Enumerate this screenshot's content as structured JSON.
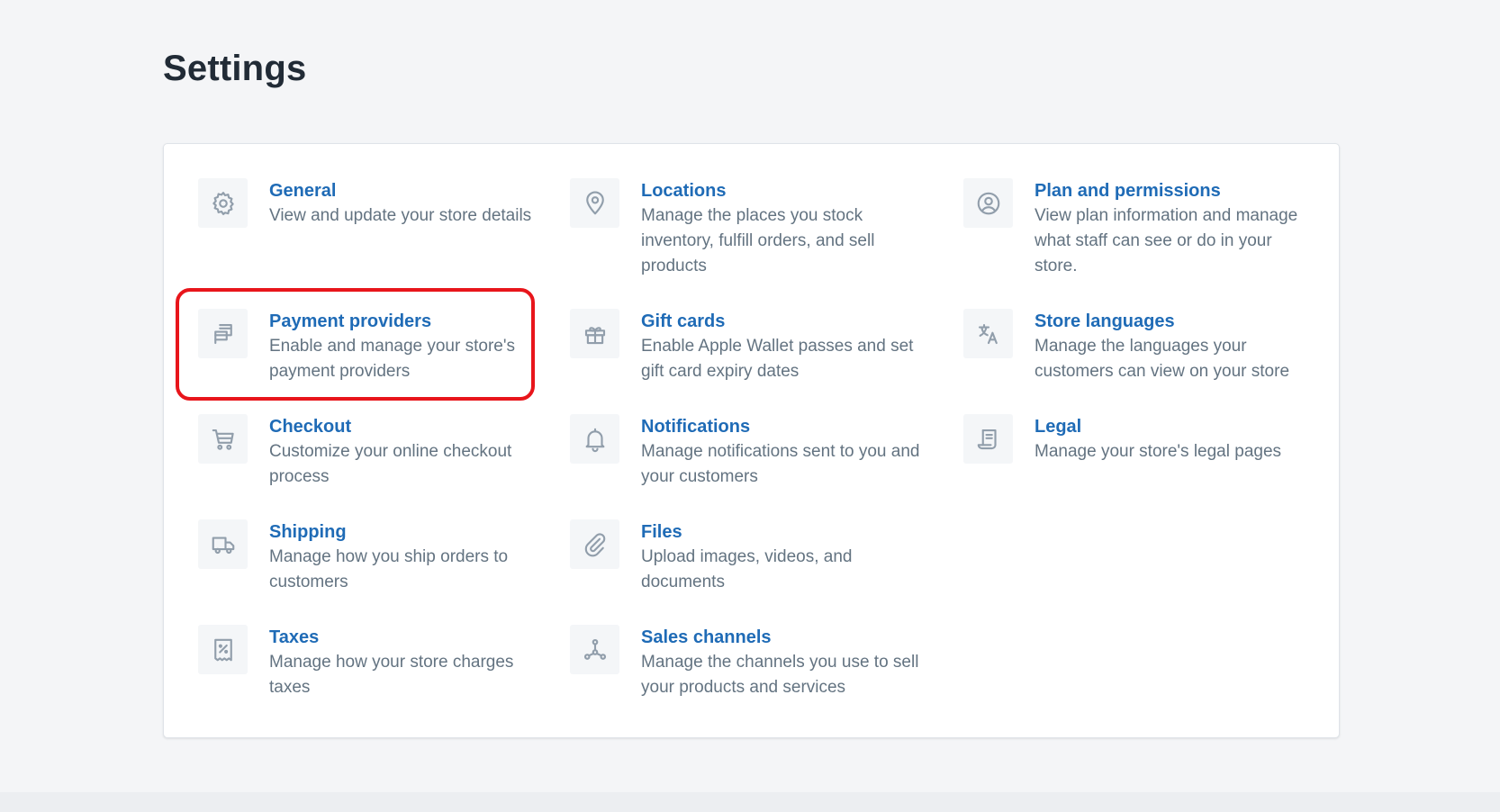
{
  "page": {
    "title": "Settings"
  },
  "settings": [
    {
      "title": "General",
      "desc": "View and update your store details",
      "icon": "gear-icon"
    },
    {
      "title": "Locations",
      "desc": "Manage the places you stock inventory, fulfill orders, and sell products",
      "icon": "location-pin-icon"
    },
    {
      "title": "Plan and permissions",
      "desc": "View plan information and manage what staff can see or do in your store.",
      "icon": "user-circle-icon"
    },
    {
      "title": "Payment providers",
      "desc": "Enable and manage your store's payment providers",
      "icon": "payment-cards-icon"
    },
    {
      "title": "Gift cards",
      "desc": "Enable Apple Wallet passes and set gift card expiry dates",
      "icon": "gift-icon"
    },
    {
      "title": "Store languages",
      "desc": "Manage the languages your customers can view on your store",
      "icon": "translate-icon"
    },
    {
      "title": "Checkout",
      "desc": "Customize your online checkout process",
      "icon": "cart-icon"
    },
    {
      "title": "Notifications",
      "desc": "Manage notifications sent to you and your customers",
      "icon": "bell-icon"
    },
    {
      "title": "Legal",
      "desc": "Manage your store's legal pages",
      "icon": "legal-document-icon"
    },
    {
      "title": "Shipping",
      "desc": "Manage how you ship orders to customers",
      "icon": "truck-icon"
    },
    {
      "title": "Files",
      "desc": "Upload images, videos, and documents",
      "icon": "paperclip-icon"
    },
    {
      "title": "Taxes",
      "desc": "Manage how your store charges taxes",
      "icon": "tax-receipt-icon"
    },
    {
      "title": "Sales channels",
      "desc": "Manage the channels you use to sell your products and services",
      "icon": "sales-channels-icon"
    }
  ],
  "colors": {
    "link": "#1f6bb6",
    "description": "#637381",
    "highlight": "#e8151b",
    "background": "#f4f5f7"
  }
}
